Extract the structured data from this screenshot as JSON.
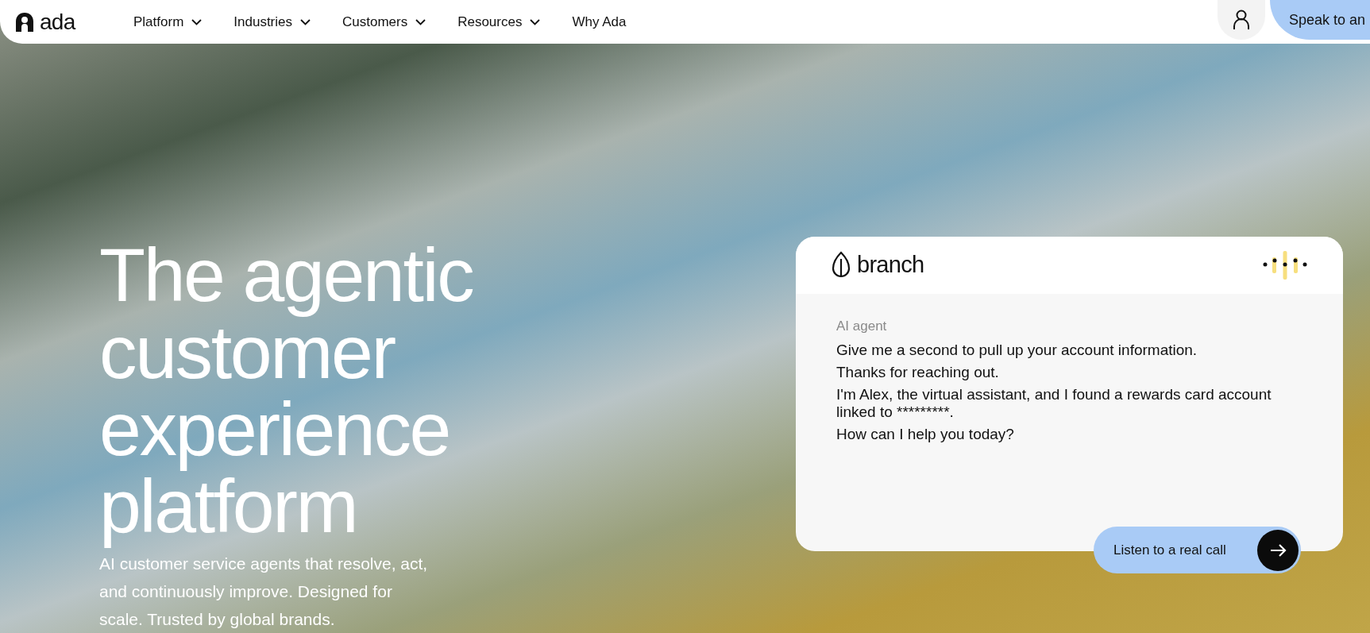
{
  "nav": {
    "logo": "ada",
    "items": [
      {
        "label": "Platform",
        "dropdown": true
      },
      {
        "label": "Industries",
        "dropdown": true
      },
      {
        "label": "Customers",
        "dropdown": true
      },
      {
        "label": "Resources",
        "dropdown": true
      },
      {
        "label": "Why Ada",
        "dropdown": false
      }
    ],
    "cta": "Speak to an"
  },
  "hero": {
    "headline_lines": [
      "The agentic",
      "customer",
      "experience",
      "platform"
    ],
    "subtitle": "AI customer service agents that resolve, act, and continuously improve. Designed for scale. Trusted by global brands."
  },
  "chat_card": {
    "brand": "branch",
    "speaker": "AI agent",
    "messages": [
      "Give me a second to pull up your account information.",
      "Thanks for reaching out.",
      "I'm Alex, the virtual assistant, and I found a rewards card account linked to *********.",
      "How can I help you today?"
    ],
    "button": "Listen to a real call"
  }
}
